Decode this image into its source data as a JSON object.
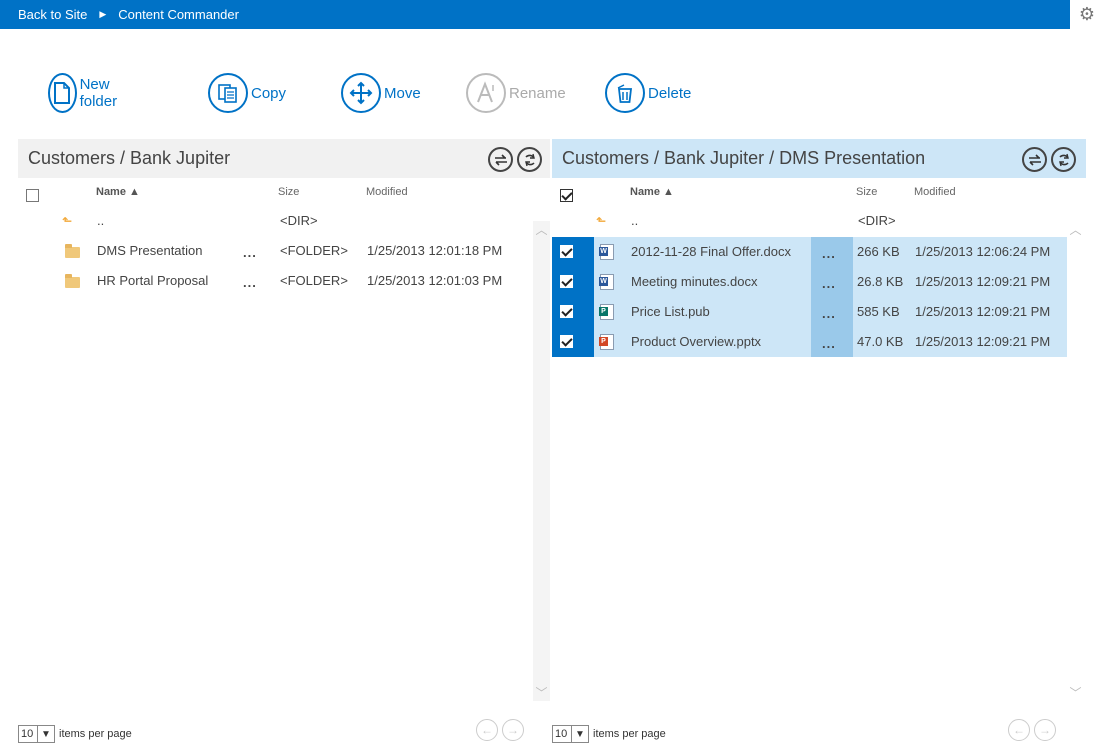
{
  "topbar": {
    "back_label": "Back to Site",
    "separator": "▶",
    "app_title": "Content Commander"
  },
  "toolbar": {
    "new_folder": "New folder",
    "copy": "Copy",
    "move": "Move",
    "rename": "Rename",
    "delete": "Delete"
  },
  "left_pane": {
    "path": "Customers / Bank Jupiter",
    "columns": {
      "name": "Name ▲",
      "size": "Size",
      "modified": "Modified"
    },
    "rows": [
      {
        "name": "..",
        "size": "<DIR>",
        "modified": ""
      },
      {
        "name": "DMS Presentation",
        "dots": "...",
        "size": "<FOLDER>",
        "modified": "1/25/2013 12:01:18 PM"
      },
      {
        "name": "HR Portal Proposal",
        "dots": "...",
        "size": "<FOLDER>",
        "modified": "1/25/2013 12:01:03 PM"
      }
    ],
    "footer": {
      "page_size": "10",
      "items_per_page": "items per page"
    }
  },
  "right_pane": {
    "path": "Customers / Bank Jupiter / DMS Presentation",
    "columns": {
      "name": "Name ▲",
      "size": "Size",
      "modified": "Modified"
    },
    "rows": [
      {
        "name": "..",
        "size": "<DIR>",
        "modified": ""
      },
      {
        "name": "2012-11-28 Final Offer.docx",
        "dots": "...",
        "size": "266 KB",
        "modified": "1/25/2013 12:06:24 PM",
        "type": "word"
      },
      {
        "name": "Meeting minutes.docx",
        "dots": "...",
        "size": "26.8 KB",
        "modified": "1/25/2013 12:09:21 PM",
        "type": "word"
      },
      {
        "name": "Price List.pub",
        "dots": "...",
        "size": "585 KB",
        "modified": "1/25/2013 12:09:21 PM",
        "type": "publisher"
      },
      {
        "name": "Product Overview.pptx",
        "dots": "...",
        "size": "47.0 KB",
        "modified": "1/25/2013 12:09:21 PM",
        "type": "powerpoint"
      }
    ],
    "footer": {
      "page_size": "10",
      "items_per_page": "items per page"
    }
  },
  "icons": {
    "settings": "gear-icon",
    "swap": "swap-icon",
    "refresh": "refresh-icon",
    "prev": "arrow-left-icon",
    "next": "arrow-right-icon"
  },
  "colors": {
    "accent": "#0072c6",
    "selection": "#cde6f7",
    "selection_strip": "#0072c6"
  }
}
